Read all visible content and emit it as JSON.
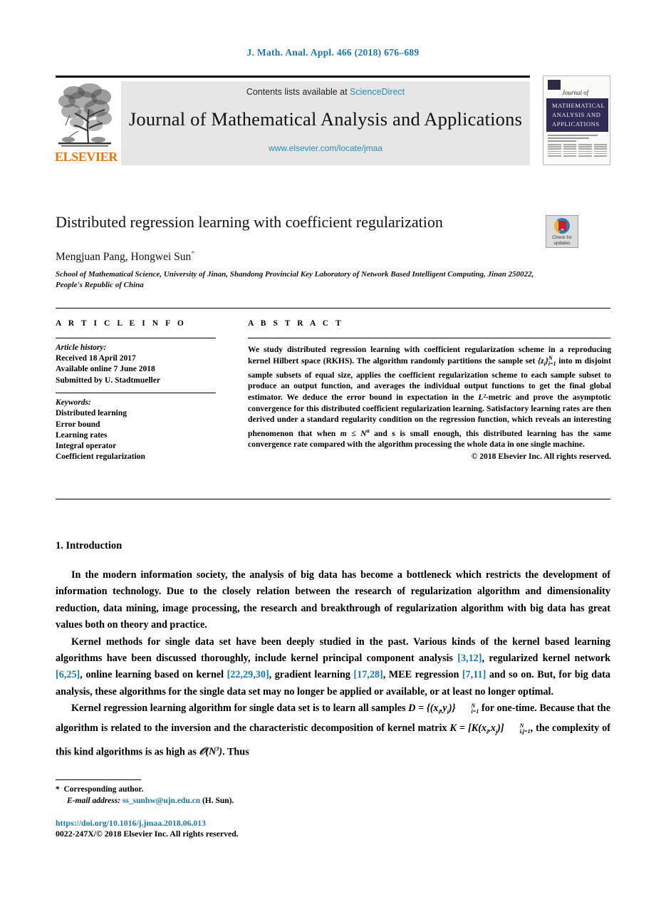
{
  "running_head": "J. Math. Anal. Appl. 466 (2018) 676–689",
  "masthead": {
    "contents_prefix": "Contents lists available at ",
    "sciencedirect_link": "ScienceDirect",
    "journal_title": "Journal of Mathematical Analysis and Applications",
    "journal_url": "www.elsevier.com/locate/jmaa",
    "publisher_logo_text": "ELSEVIER",
    "cover": {
      "journal_of": "Journal of",
      "title_lines": [
        "MATHEMATICAL",
        "ANALYSIS AND",
        "APPLICATIONS"
      ]
    }
  },
  "article": {
    "title": "Distributed regression learning with coefficient regularization",
    "authors": "Mengjuan Pang, Hongwei Sun",
    "corresponding_marker": "*",
    "affiliation": "School of Mathematical Science, University of Jinan, Shandong Provincial Key Laboratory of Network Based Intelligent Computing, Jinan 250022, People's Republic of China",
    "crossmark_badge": {
      "line1": "Check for",
      "line2": "updates"
    }
  },
  "article_info": {
    "heading": "A R T I C L E   I N F O",
    "history_label": "Article history:",
    "history": [
      "Received 18 April 2017",
      "Available online 7 June 2018",
      "Submitted by U. Stadtmueller"
    ],
    "keywords_label": "Keywords:",
    "keywords": [
      "Distributed learning",
      "Error bound",
      "Learning rates",
      "Integral operator",
      "Coefficient regularization"
    ]
  },
  "abstract": {
    "heading": "A B S T R A C T",
    "part1": "We study distributed regression learning with coefficient regularization scheme in a reproducing kernel Hilbert space (RKHS). The algorithm randomly partitions the sample set ",
    "math_sampleset": "{z",
    "part2": " into m disjoint sample subsets of equal size, applies the coefficient regularization scheme to each sample subset to produce an output function, and averages the individual output functions to get the final global estimator. We deduce the error bound in expectation in the ",
    "math_l2": "L²",
    "part3": "-metric and prove the asymptotic convergence for this distributed coefficient regularization learning. Satisfactory learning rates are then derived under a standard regularity condition on the regression function, which reveals an interesting phenomenon that when ",
    "math_cond": "m ≤ N",
    "part4": " and s is small enough, this distributed learning has the same convergence rate compared with the algorithm processing the whole data in one single machine.",
    "copyright": "© 2018 Elsevier Inc. All rights reserved."
  },
  "section": {
    "number_title": "1.  Introduction",
    "paragraphs": [
      "In the modern information society, the analysis of big data has become a bottleneck which restricts the development of information technology. Due to the closely relation between the research of regularization algorithm and dimensionality reduction, data mining, image processing, the research and breakthrough of regularization algorithm with big data has great values both on theory and practice."
    ],
    "p2": {
      "a": "Kernel methods for single data set have been deeply studied in the past. Various kinds of the kernel based learning algorithms have been discussed thoroughly, include kernel principal component analysis ",
      "c1": "[3,12]",
      "b": ", regularized kernel network ",
      "c2": "[6,25]",
      "c": ", online learning based on kernel ",
      "c3": "[22,29,30]",
      "d": ", gradient learning ",
      "c4": "[17,28]",
      "e": ", MEE regression ",
      "c5": "[7,11]",
      "f": " and so on. But, for big data analysis, these algorithms for the single data set may no longer be applied or available, or at least no longer optimal."
    },
    "p3": {
      "a": "Kernel regression learning algorithm for single data set is to learn all samples ",
      "b": " for one-time. Because that the algorithm is related to the inversion and the characteristic decomposition of kernel matrix ",
      "c": ", the complexity of this kind algorithms is as high as ",
      "d": ". Thus"
    }
  },
  "footer": {
    "corresponding_note": "Corresponding author.",
    "email_label": "E-mail address:",
    "email": "ss_sunhw@ujn.edu.cn",
    "email_suffix": "(H. Sun).",
    "doi": "https://doi.org/10.1016/j.jmaa.2018.06.013",
    "issn_line": "0022-247X/© 2018 Elsevier Inc. All rights reserved."
  },
  "colors": {
    "link_blue": "#1a7aad",
    "sciencedirect_blue": "#2a8bb5",
    "elsevier_orange": "#ec7404",
    "banner_gray": "#e6e6e6",
    "cover_navy": "#2f2b55"
  }
}
